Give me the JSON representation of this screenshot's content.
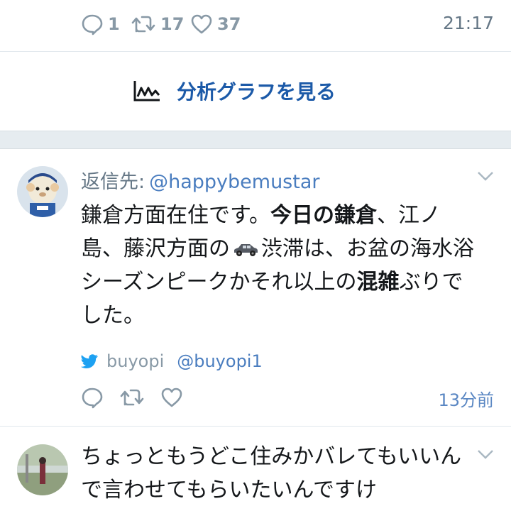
{
  "top_actions": {
    "reply_count": "1",
    "retweet_count": "17",
    "like_count": "37",
    "time": "21:17"
  },
  "analytics": {
    "label": "分析グラフを見る",
    "icon": "analytics-chart-icon"
  },
  "tweet1": {
    "reply_prefix": "返信先:",
    "reply_handle": "@happybemustar",
    "text_parts": {
      "p1": "鎌倉方面在住です。",
      "p2_bold": "今日の鎌倉",
      "p3": "、江ノ島、藤沢方面の",
      "p4": "渋滞は、お盆の海水浴シーズンピークかそれ以上の",
      "p5_bold": "混雑",
      "p6": "ぶりでした。"
    },
    "source_name": "buyopi",
    "source_handle": "@buyopi1",
    "time": "13分前"
  },
  "tweet2": {
    "text": "ちょっともうどこ住みかバレてもいいんで言わせてもらいたいんですけ"
  },
  "colors": {
    "link_blue": "#1c5aa8",
    "handle_blue": "#4a7dbf",
    "gray": "#8899a6",
    "divider": "#e1e8ed"
  }
}
